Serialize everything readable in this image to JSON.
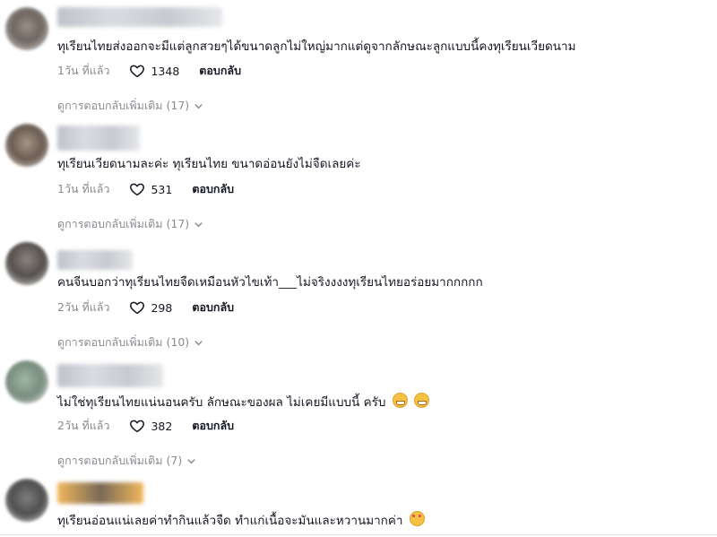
{
  "comments": [
    {
      "text": "ทุเรียนไทยส่งออกจะมีแต่ลูกสวยๆได้ขนาดลูกไม่ใหญ่มากแต่ดูจากลักษณะลูกแบบนี้คงทุเรียนเวียดนาม",
      "time": "1วัน ที่แล้ว",
      "likes": "1348",
      "reply": "ตอบกลับ",
      "more_replies": "ดูการตอบกลับเพิ่มเติม (17)"
    },
    {
      "text": "ทุเรียนเวียดนามละค่ะ ทุเรียนไทย ขนาดอ่อนยังไม่จืดเลยค่ะ",
      "time": "1วัน ที่แล้ว",
      "likes": "531",
      "reply": "ตอบกลับ",
      "more_replies": "ดูการตอบกลับเพิ่มเติม (17)"
    },
    {
      "text": "คนจีนบอกว่าทุเรียนไทยจืดเหมือนหัวไขเท้า___ไม่จริงงงงทุเรียนไทยอร่อยมากกกกก",
      "time": "2วัน ที่แล้ว",
      "likes": "298",
      "reply": "ตอบกลับ",
      "more_replies": "ดูการตอบกลับเพิ่มเติม (10)"
    },
    {
      "text": "ไม่ใช่ทุเรียนไทยแน่นอนครับ ลักษณะของผล ไม่เคยมีแบบนี้ ครับ",
      "time": "2วัน ที่แล้ว",
      "likes": "382",
      "reply": "ตอบกลับ",
      "more_replies": "ดูการตอบกลับเพิ่มเติม (7)"
    },
    {
      "text": "ทุเรียนอ่อนแน่เลยค่าทำกินแล้วจืด ทำแก่เนื้อจะมันและหวานมากค่า"
    }
  ],
  "icons": {
    "like": "heart-outline-icon",
    "expand": "chevron-down-icon",
    "grin_emoji": "grinning-emoji-icon",
    "love_emoji": "heart-eyes-emoji-icon"
  }
}
